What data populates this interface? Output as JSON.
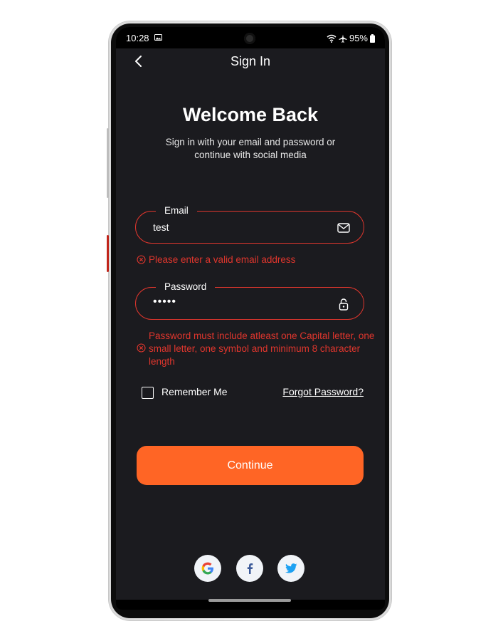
{
  "status_bar": {
    "time": "10:28",
    "battery": "95%"
  },
  "header": {
    "title": "Sign In"
  },
  "welcome": {
    "title": "Welcome Back",
    "subtitle_line1": "Sign in with your email and password or",
    "subtitle_line2": "continue with social media"
  },
  "email_field": {
    "label": "Email",
    "value": "test",
    "error": "Please enter a valid email address",
    "icon": "mail-icon"
  },
  "password_field": {
    "label": "Password",
    "value": "•••••",
    "error": "Password must include atleast one Capital letter, one small letter, one symbol and minimum 8 character length",
    "icon": "lock-icon"
  },
  "remember_me": {
    "label": "Remember Me",
    "checked": false
  },
  "forgot_password": {
    "label": "Forgot Password?"
  },
  "continue_button": {
    "label": "Continue"
  },
  "social_buttons": [
    "google-icon",
    "facebook-icon",
    "twitter-icon"
  ],
  "colors": {
    "background": "#1b1b1f",
    "accent": "#ff6525",
    "error": "#e0362d",
    "text": "#ffffff"
  }
}
